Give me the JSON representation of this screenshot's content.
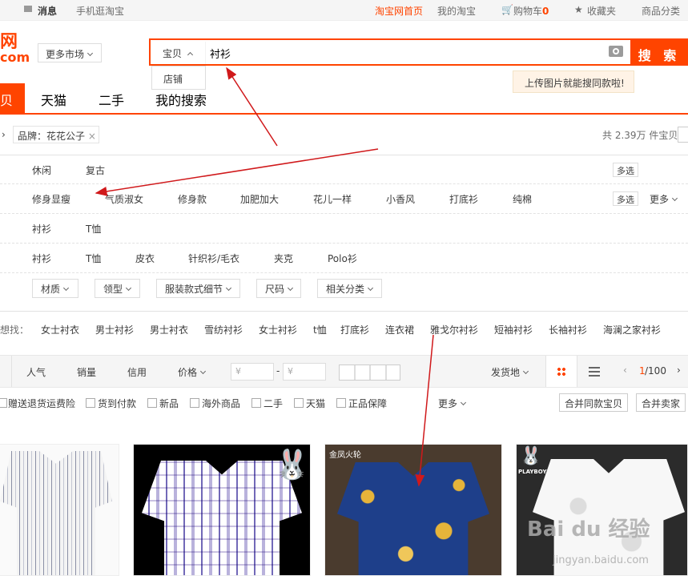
{
  "topbar": {
    "messages": "消息",
    "mobile": "手机逛淘宝",
    "home": "淘宝网首页",
    "my_taobao": "我的淘宝",
    "cart_label": "购物车",
    "cart_count": "0",
    "favorites": "收藏夹",
    "categories": "商品分类"
  },
  "header": {
    "logo_line1": "网",
    "logo_line2": "com",
    "more_markets": "更多市场",
    "search_type": "宝贝",
    "search_value": "衬衫",
    "search_button": "搜 索",
    "dropdown_option": "店铺",
    "image_search_tip": "上传图片就能搜同款啦!"
  },
  "nav": {
    "tabs": [
      "贝",
      "天猫",
      "二手",
      "我的搜索"
    ]
  },
  "filter": {
    "brand_tag": "品牌：花花公子",
    "result_count": "共 2.39万 件宝贝",
    "row1": [
      "休闲",
      "复古"
    ],
    "row2": [
      "修身显瘦",
      "气质淑女",
      "修身款",
      "加肥加大",
      "花儿一样",
      "小香风",
      "打底衫",
      "纯棉"
    ],
    "row3": [
      "衬衫",
      "T恤"
    ],
    "row4": [
      "衬衫",
      "T恤",
      "皮衣",
      "针织衫/毛衣",
      "夹克",
      "Polo衫"
    ],
    "multi_select": "多选",
    "more": "更多",
    "dropdowns": [
      "材质",
      "领型",
      "服装款式细节",
      "尺码",
      "相关分类"
    ]
  },
  "related": {
    "label": "想找：",
    "items": [
      "女士衬衣",
      "男士衬衫",
      "男士衬衣",
      "雪纺衬衫",
      "女士衬衫",
      "t恤",
      "打底衫",
      "连衣裙",
      "雅戈尔衬衫",
      "短袖衬衫",
      "长袖衬衫",
      "海澜之家衬衫"
    ]
  },
  "sort": {
    "options": [
      "人气",
      "销量",
      "信用",
      "价格"
    ],
    "price_placeholder": "¥",
    "price_dash": "-",
    "location": "发货地",
    "page": "1",
    "pages": "/100"
  },
  "options": {
    "checkboxes": [
      "赠送退货运费险",
      "货到付款",
      "新品",
      "海外商品",
      "二手",
      "天猫",
      "正品保障"
    ],
    "more": "更多",
    "merge_same": "合并同款宝贝",
    "merge_seller": "合并卖家"
  },
  "products": {
    "badge3": "金凤火轮",
    "badge4": "PLAYBOY"
  },
  "watermark": {
    "brand": "Bai du 经验",
    "url": "jingyan.baidu.com"
  },
  "colors": {
    "accent": "#ff4400",
    "annotation": "#d0191b"
  }
}
